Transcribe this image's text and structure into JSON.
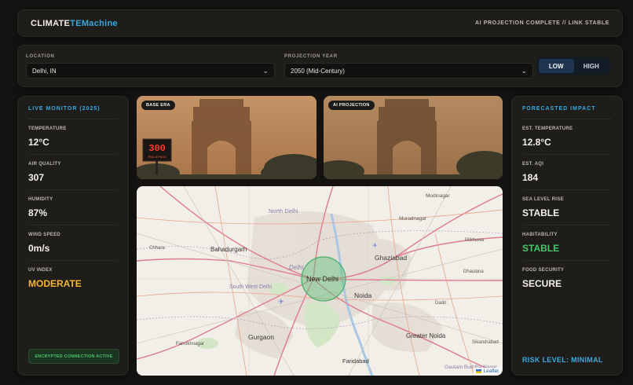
{
  "header": {
    "brand_part1": "CLIMATE",
    "brand_part2": "TEMachine",
    "status": "AI PROJECTION COMPLETE // LINK STABLE"
  },
  "controls": {
    "location_label": "LOCATION",
    "location_value": "Delhi, IN",
    "year_label": "PROJECTION YEAR",
    "year_value": "2050 (Mid-Century)",
    "scenario_low": "LOW",
    "scenario_high": "HIGH",
    "scenario_selected": "LOW"
  },
  "live": {
    "title": "LIVE MONITOR (2025)",
    "metrics": [
      {
        "label": "TEMPERATURE",
        "value": "12°C"
      },
      {
        "label": "AIR QUALITY",
        "value": "307"
      },
      {
        "label": "HUMIDITY",
        "value": "87%"
      },
      {
        "label": "WIND SPEED",
        "value": "0m/s"
      },
      {
        "label": "UV INDEX",
        "value": "MODERATE"
      }
    ],
    "connection": "ENCRYPTED CONNECTION ACTIVE"
  },
  "forecast": {
    "title": "FORECASTED IMPACT",
    "metrics": [
      {
        "label": "EST. TEMPERATURE",
        "value": "12.8°C"
      },
      {
        "label": "EST. AQI",
        "value": "184"
      },
      {
        "label": "SEA LEVEL RISE",
        "value": "STABLE"
      },
      {
        "label": "HABITABILITY",
        "value": "STABLE"
      },
      {
        "label": "FOOD SECURITY",
        "value": "SECURE"
      }
    ],
    "risk": "RISK LEVEL: MINIMAL"
  },
  "images": {
    "base_tag": "BASE ERA",
    "ai_tag": "AI PROJECTION",
    "sign_number": "300",
    "sign_text": "PM2.5 PM10"
  },
  "map": {
    "attribution": "Leaflet",
    "places": {
      "modinagar": "Modinagar",
      "north_delhi": "North Delhi",
      "muradnagar": "Muradnagar",
      "bahadurgarh": "Bahadurgarh",
      "ghaziabad": "Ghaziabad",
      "pilkhuwa": "Pilkhuwa",
      "chhara": "Chhara",
      "delhi": "Delhi",
      "new_delhi": "New Delhi",
      "dhaulana": "Dhaulana",
      "south_west_delhi": "South West Delhi",
      "noida": "Noida",
      "dadri": "Dadri",
      "farrukhnagar": "Farrukhnagar",
      "gurgaon": "Gurgaon",
      "greater_noida": "Greater Noida",
      "sikandrabad": "Sikandrabad",
      "faridabad": "Faridabad",
      "gautam_buddha_nagar": "Gautam Buddha Nagar"
    }
  },
  "colors": {
    "accent": "#38a8dc",
    "warning": "#f2b531",
    "success": "#43c76a"
  }
}
